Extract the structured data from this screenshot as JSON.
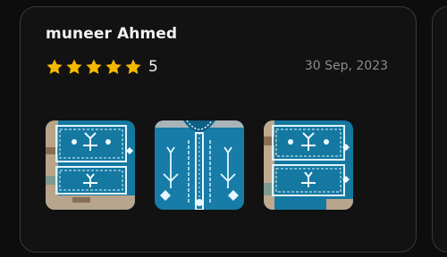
{
  "review": {
    "reviewer_name": "muneer Ahmed",
    "rating": 5,
    "rating_label": "5",
    "star_count": 5,
    "star_color": "#f5b800",
    "date": "30 Sep, 2023",
    "images": [
      {
        "name": "review-image-1",
        "pattern": "embroidered-panel"
      },
      {
        "name": "review-image-2",
        "pattern": "embroidered-shirt-front"
      },
      {
        "name": "review-image-3",
        "pattern": "embroidered-panel"
      }
    ]
  },
  "colors": {
    "background": "#0d0d0d",
    "card": "#121212",
    "border": "#3a3a3a",
    "text_primary": "#f2f2f2",
    "text_secondary": "#8c8c8c",
    "fabric_blue": "#1478a0"
  }
}
